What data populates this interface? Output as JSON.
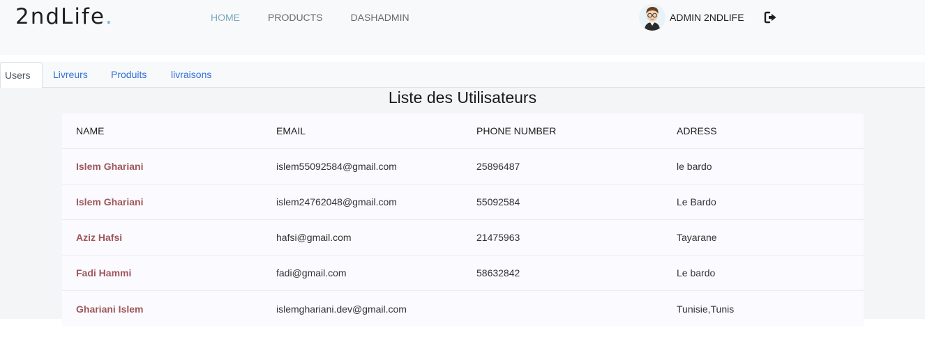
{
  "brand": {
    "name": "2ndLife",
    "dot": "."
  },
  "nav": {
    "links": [
      {
        "label": "HOME",
        "active": true
      },
      {
        "label": "PRODUCTS",
        "active": false
      },
      {
        "label": "DASHADMIN",
        "active": false
      }
    ]
  },
  "user": {
    "name": "ADMIN 2NDLIFE",
    "avatar_icon": "avatar-icon",
    "logout_icon": "sign-out-icon"
  },
  "tabs": [
    {
      "label": "Users",
      "active": true
    },
    {
      "label": "Livreurs",
      "active": false
    },
    {
      "label": "Produits",
      "active": false
    },
    {
      "label": "livraisons",
      "active": false
    }
  ],
  "page": {
    "title": "Liste des Utilisateurs"
  },
  "table": {
    "headers": [
      "NAME",
      "EMAIL",
      "PHONE NUMBER",
      "ADRESS"
    ],
    "rows": [
      {
        "name": "Islem Ghariani",
        "email": "islem55092584@gmail.com",
        "phone": "25896487",
        "address": "le bardo"
      },
      {
        "name": "Islem Ghariani",
        "email": "islem24762048@gmail.com",
        "phone": "55092584",
        "address": "Le Bardo"
      },
      {
        "name": "Aziz Hafsi",
        "email": "hafsi@gmail.com",
        "phone": "21475963",
        "address": "Tayarane"
      },
      {
        "name": "Fadi Hammi",
        "email": "fadi@gmail.com",
        "phone": "58632842",
        "address": "Le bardo"
      },
      {
        "name": "Ghariani Islem",
        "email": "islemghariani.dev@gmail.com",
        "phone": "",
        "address": "Tunisie,Tunis"
      }
    ]
  },
  "colors": {
    "nav_active": "#7aa9c0",
    "tab_link": "#2f6fd6",
    "name_text": "#a0575a",
    "brand_dot": "#6bb6d6"
  }
}
